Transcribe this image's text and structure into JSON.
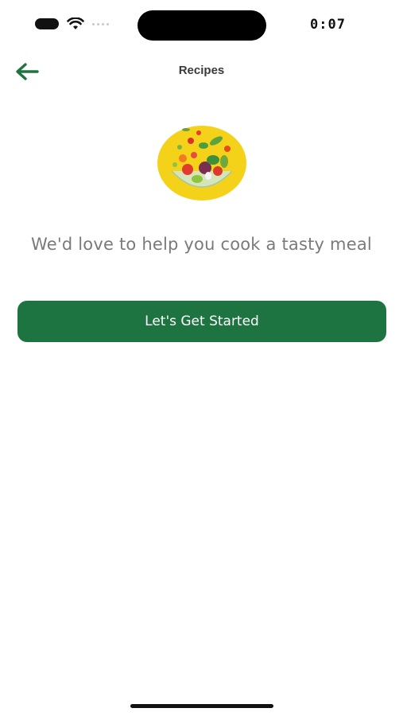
{
  "status_bar": {
    "time": "0:07",
    "icons": [
      "battery-icon",
      "wifi-icon",
      "signal-dots-icon"
    ]
  },
  "header": {
    "title": "Recipes",
    "back_icon": "arrow-left-icon"
  },
  "illustration": {
    "icon": "salad-bowl-illustration"
  },
  "main": {
    "tagline": "We'd love to help you cook a tasty meal",
    "cta_label": "Let's Get Started"
  },
  "colors": {
    "primary_green": "#1e7440",
    "illustration_yellow": "#f5d21a",
    "title_text": "#3a3a3a",
    "tagline_text": "#7a7a7a"
  }
}
